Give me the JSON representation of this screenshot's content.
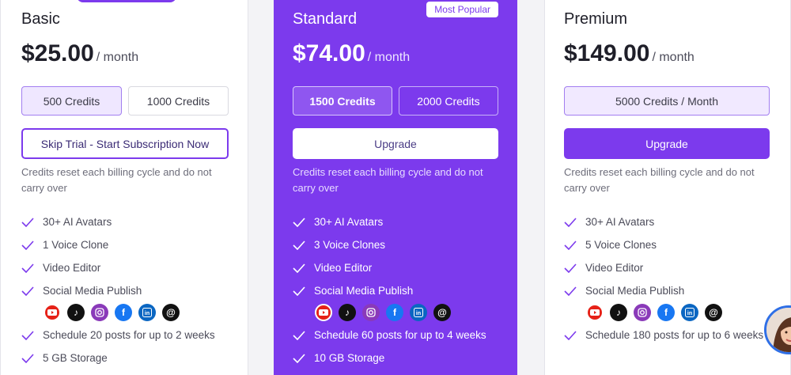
{
  "plans": [
    {
      "name": "Basic",
      "price": "$25.00",
      "period": "/ month",
      "credit_options": [
        "500 Credits",
        "1000 Credits"
      ],
      "action": "Skip Trial - Start Subscription Now",
      "note": "Credits reset each billing cycle and do not carry over",
      "features": [
        "30+ AI Avatars",
        "1 Voice Clone",
        "Video Editor",
        "Social Media Publish",
        "Schedule 20 posts for up to 2 weeks",
        "5 GB Storage"
      ]
    },
    {
      "name": "Standard",
      "badge": "Most Popular",
      "price": "$74.00",
      "period": "/ month",
      "credit_options": [
        "1500 Credits",
        "2000 Credits"
      ],
      "action": "Upgrade",
      "note": "Credits reset each billing cycle and do not carry over",
      "features": [
        "30+ AI Avatars",
        "3 Voice Clones",
        "Video Editor",
        "Social Media Publish",
        "Schedule 60 posts for up to 4 weeks",
        "10 GB Storage"
      ]
    },
    {
      "name": "Premium",
      "price": "$149.00",
      "period": "/ month",
      "credit_options": [
        "5000 Credits / Month"
      ],
      "action": "Upgrade",
      "note": "Credits reset each billing cycle and do not carry over",
      "features": [
        "30+ AI Avatars",
        "5 Voice Clones",
        "Video Editor",
        "Social Media Publish",
        "Schedule 180 posts for up to 6 weeks"
      ]
    }
  ],
  "social_icons": [
    {
      "name": "youtube-icon",
      "color": "#e62117"
    },
    {
      "name": "tiktok-icon",
      "color": "#111111"
    },
    {
      "name": "instagram-icon",
      "color": "#8a3ab9"
    },
    {
      "name": "facebook-icon",
      "color": "#1877f2"
    },
    {
      "name": "linkedin-icon",
      "color": "#0a66c2"
    },
    {
      "name": "threads-icon",
      "color": "#111111"
    }
  ],
  "colors": {
    "accent": "#7c3aed",
    "selected_bg": "#efe7ff",
    "check": "#7c3aed"
  }
}
